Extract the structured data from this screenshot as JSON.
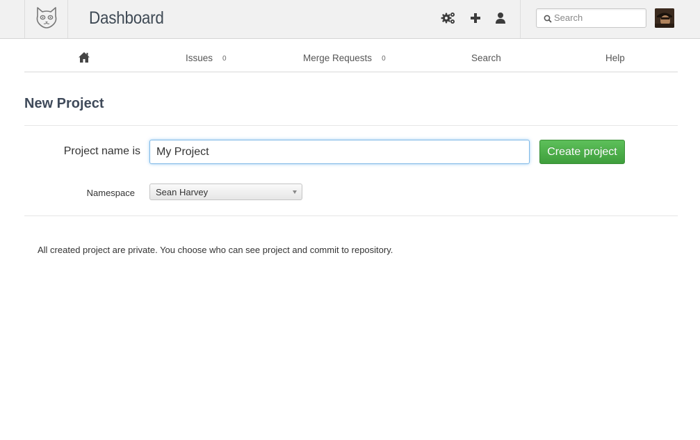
{
  "header": {
    "title": "Dashboard",
    "icons": [
      "admin-gears-icon",
      "new-project-plus-icon",
      "profile-user-icon"
    ],
    "search": {
      "placeholder": "Search",
      "value": ""
    }
  },
  "nav": {
    "home_icon": "home-icon",
    "issues": {
      "label": "Issues",
      "count": "0"
    },
    "merge_requests": {
      "label": "Merge Requests",
      "count": "0"
    },
    "search_label": "Search",
    "help_label": "Help"
  },
  "page": {
    "title": "New Project",
    "form": {
      "name_label": "Project name is",
      "name_value": "My Project",
      "create_button": "Create project",
      "namespace_label": "Namespace",
      "namespace_value": "Sean Harvey"
    },
    "note": "All created project are private. You choose who can see project and commit to repository."
  },
  "colors": {
    "accent_green": "#47a447",
    "focus_blue": "#52a8ec",
    "header_bg": "#f1f1f1",
    "title_text": "#3f4a5a"
  }
}
